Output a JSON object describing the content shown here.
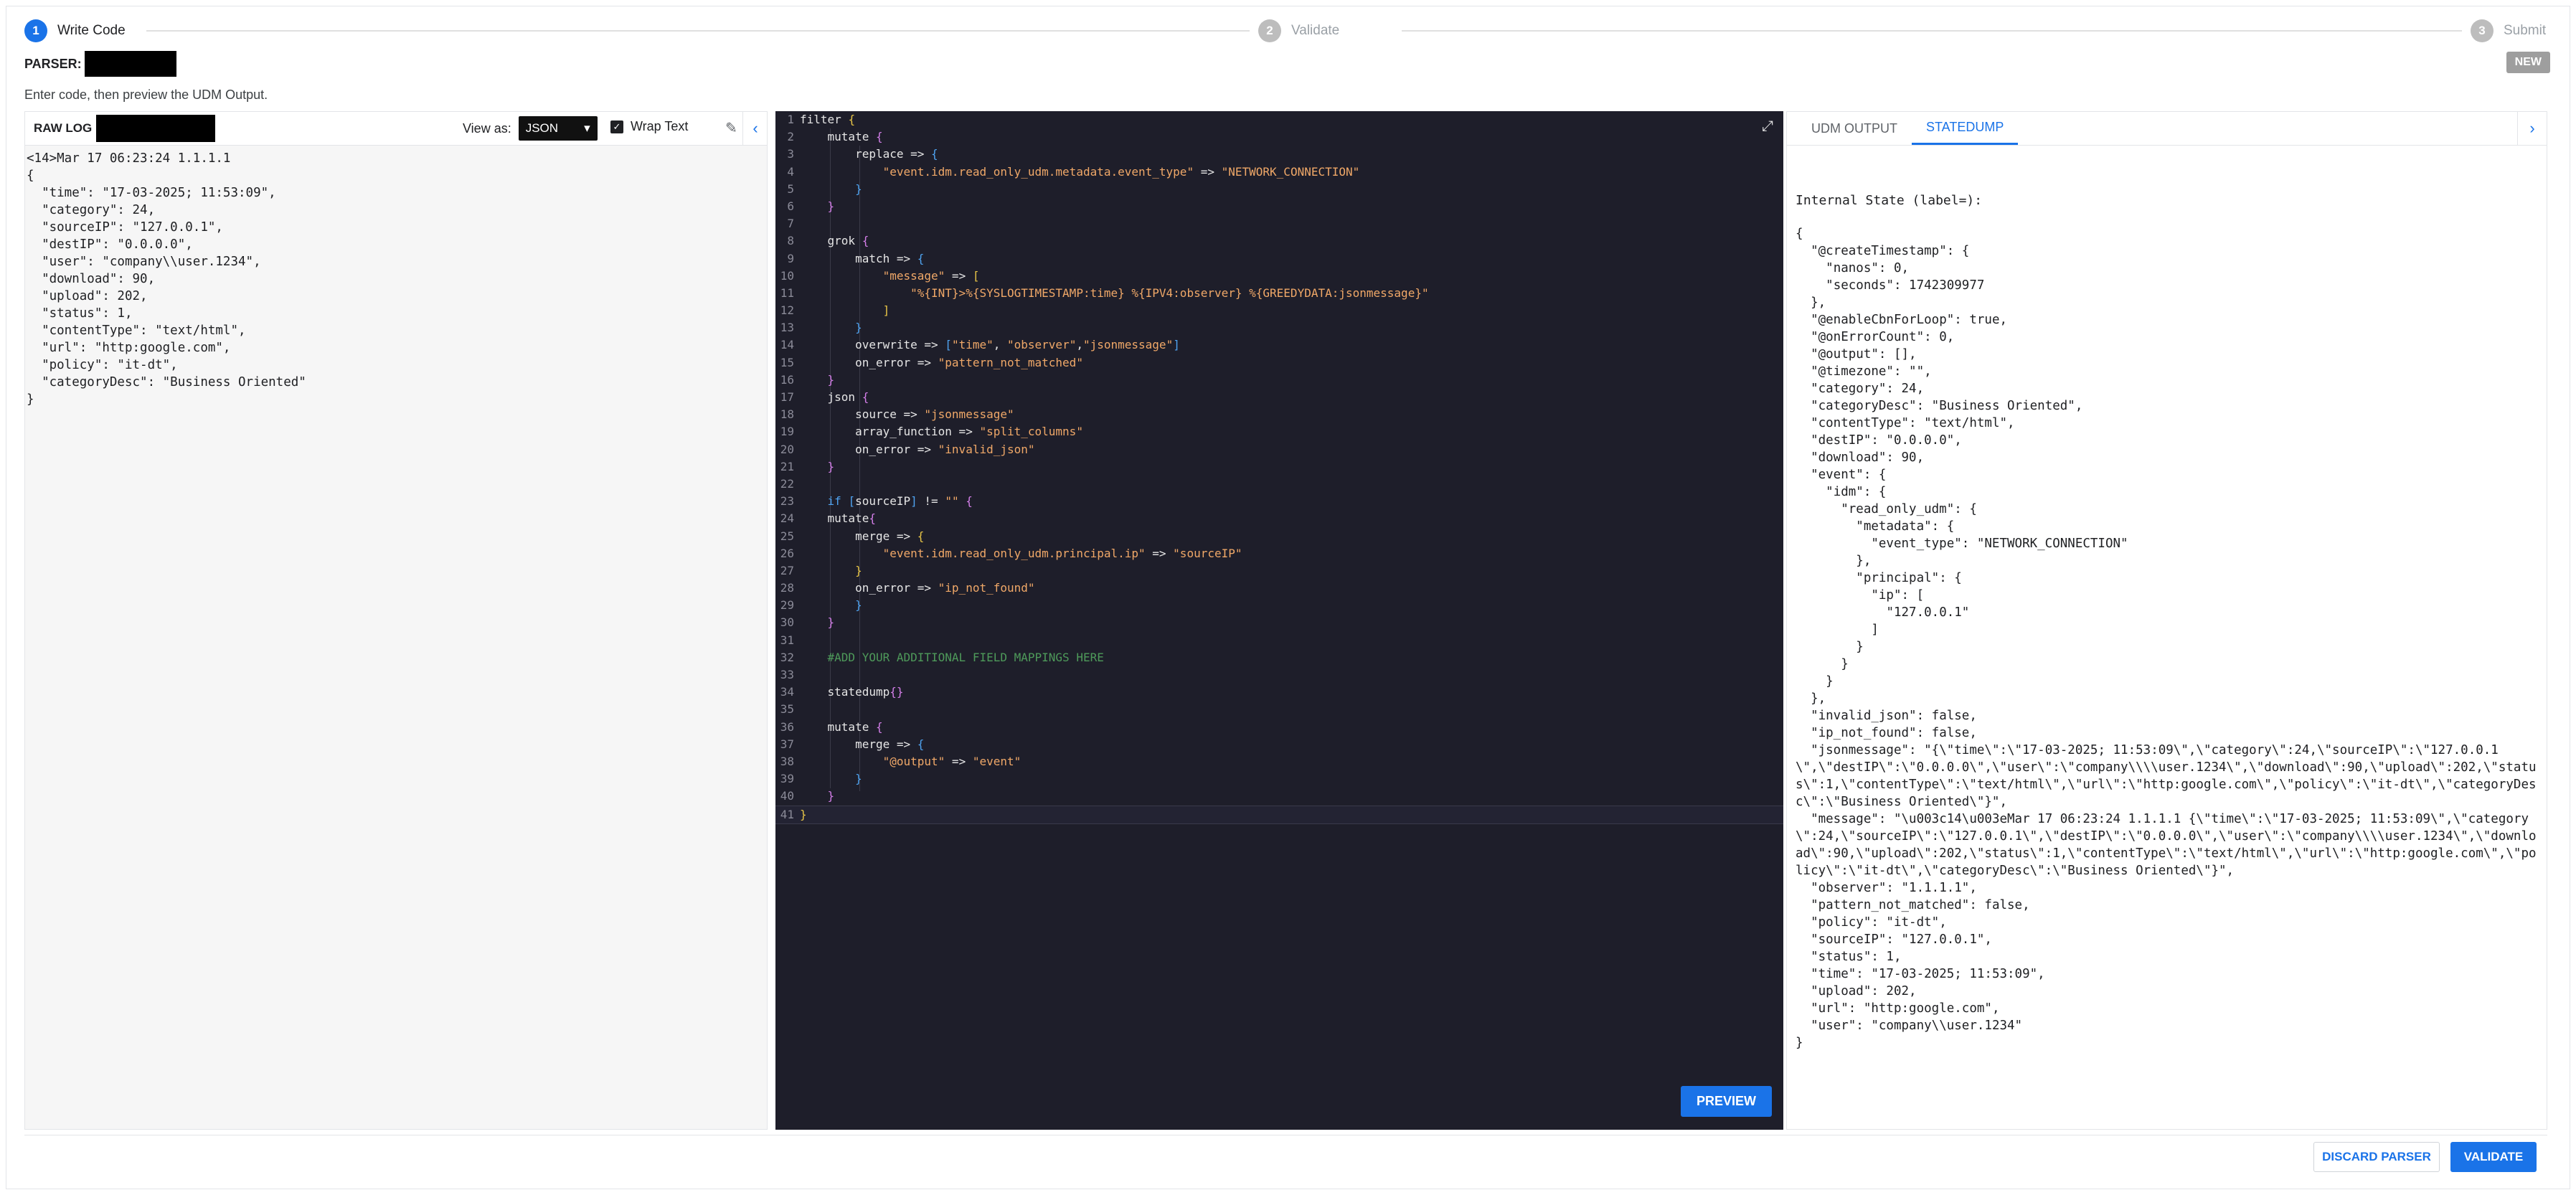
{
  "stepper": {
    "steps": [
      {
        "num": "1",
        "label": "Write Code"
      },
      {
        "num": "2",
        "label": "Validate"
      },
      {
        "num": "3",
        "label": "Submit"
      }
    ]
  },
  "header": {
    "parser_label": "PARSER:",
    "new_badge": "NEW",
    "instructions": "Enter code, then preview the UDM Output."
  },
  "left_panel": {
    "raw_log_label": "RAW LOG",
    "view_as_label": "View as:",
    "view_as_value": "JSON",
    "wrap_text_label": "Wrap Text",
    "raw_log_text": "<14>Mar 17 06:23:24 1.1.1.1\n{\n  \"time\": \"17-03-2025; 11:53:09\",\n  \"category\": 24,\n  \"sourceIP\": \"127.0.0.1\",\n  \"destIP\": \"0.0.0.0\",\n  \"user\": \"company\\\\user.1234\",\n  \"download\": 90,\n  \"upload\": 202,\n  \"status\": 1,\n  \"contentType\": \"text/html\",\n  \"url\": \"http:google.com\",\n  \"policy\": \"it-dt\",\n  \"categoryDesc\": \"Business Oriented\"\n}"
  },
  "editor": {
    "preview_label": "PREVIEW",
    "lines": [
      [
        {
          "t": "filter ",
          "c": "k"
        },
        {
          "t": "{",
          "c": "b1"
        }
      ],
      [
        {
          "t": "    mutate ",
          "c": "k"
        },
        {
          "t": "{",
          "c": "b2"
        }
      ],
      [
        {
          "t": "        replace => ",
          "c": "k"
        },
        {
          "t": "{",
          "c": "b3"
        }
      ],
      [
        {
          "t": "            \"event.idm.read_only_udm.metadata.event_type\"",
          "c": "s"
        },
        {
          "t": " => ",
          "c": "op"
        },
        {
          "t": "\"NETWORK_CONNECTION\"",
          "c": "s"
        }
      ],
      [
        {
          "t": "        ",
          "c": "k"
        },
        {
          "t": "}",
          "c": "b3"
        }
      ],
      [
        {
          "t": "    ",
          "c": "k"
        },
        {
          "t": "}",
          "c": "b2"
        }
      ],
      [],
      [
        {
          "t": "    grok ",
          "c": "k"
        },
        {
          "t": "{",
          "c": "b2"
        }
      ],
      [
        {
          "t": "        match => ",
          "c": "k"
        },
        {
          "t": "{",
          "c": "b3"
        }
      ],
      [
        {
          "t": "            \"message\"",
          "c": "s"
        },
        {
          "t": " => ",
          "c": "op"
        },
        {
          "t": "[",
          "c": "b1"
        }
      ],
      [
        {
          "t": "                \"%{INT}>%{SYSLOGTIMESTAMP:time} %{IPV4:observer} %{GREEDYDATA:jsonmessage}\"",
          "c": "s"
        }
      ],
      [
        {
          "t": "            ",
          "c": "k"
        },
        {
          "t": "]",
          "c": "b1"
        }
      ],
      [
        {
          "t": "        ",
          "c": "k"
        },
        {
          "t": "}",
          "c": "b3"
        }
      ],
      [
        {
          "t": "        overwrite => ",
          "c": "k"
        },
        {
          "t": "[",
          "c": "b3"
        },
        {
          "t": "\"time\"",
          "c": "s"
        },
        {
          "t": ", ",
          "c": "op"
        },
        {
          "t": "\"observer\"",
          "c": "s"
        },
        {
          "t": ",",
          "c": "op"
        },
        {
          "t": "\"jsonmessage\"",
          "c": "s"
        },
        {
          "t": "]",
          "c": "b3"
        }
      ],
      [
        {
          "t": "        on_error => ",
          "c": "k"
        },
        {
          "t": "\"pattern_not_matched\"",
          "c": "s"
        }
      ],
      [
        {
          "t": "    ",
          "c": "k"
        },
        {
          "t": "}",
          "c": "b2"
        }
      ],
      [
        {
          "t": "    json ",
          "c": "k"
        },
        {
          "t": "{",
          "c": "b2"
        }
      ],
      [
        {
          "t": "        source => ",
          "c": "k"
        },
        {
          "t": "\"jsonmessage\"",
          "c": "s"
        }
      ],
      [
        {
          "t": "        array_function => ",
          "c": "k"
        },
        {
          "t": "\"split_columns\"",
          "c": "s"
        }
      ],
      [
        {
          "t": "        on_error => ",
          "c": "k"
        },
        {
          "t": "\"invalid_json\"",
          "c": "s"
        }
      ],
      [
        {
          "t": "    ",
          "c": "k"
        },
        {
          "t": "}",
          "c": "b2"
        }
      ],
      [],
      [
        {
          "t": "    if ",
          "c": "b3"
        },
        {
          "t": "[",
          "c": "b3"
        },
        {
          "t": "sourceIP",
          "c": "k"
        },
        {
          "t": "]",
          "c": "b3"
        },
        {
          "t": " != ",
          "c": "op"
        },
        {
          "t": "\"\"",
          "c": "s"
        },
        {
          "t": " ",
          "c": "op"
        },
        {
          "t": "{",
          "c": "b2"
        }
      ],
      [
        {
          "t": "    mutate",
          "c": "k"
        },
        {
          "t": "{",
          "c": "b2"
        }
      ],
      [
        {
          "t": "        merge => ",
          "c": "k"
        },
        {
          "t": "{",
          "c": "b1"
        }
      ],
      [
        {
          "t": "            \"event.idm.read_only_udm.principal.ip\"",
          "c": "s"
        },
        {
          "t": " => ",
          "c": "op"
        },
        {
          "t": "\"sourceIP\"",
          "c": "s"
        }
      ],
      [
        {
          "t": "        ",
          "c": "k"
        },
        {
          "t": "}",
          "c": "b1"
        }
      ],
      [
        {
          "t": "        on_error => ",
          "c": "k"
        },
        {
          "t": "\"ip_not_found\"",
          "c": "s"
        }
      ],
      [
        {
          "t": "        ",
          "c": "k"
        },
        {
          "t": "}",
          "c": "b3"
        }
      ],
      [
        {
          "t": "    ",
          "c": "k"
        },
        {
          "t": "}",
          "c": "b2"
        }
      ],
      [],
      [
        {
          "t": "    #ADD YOUR ADDITIONAL FIELD MAPPINGS HERE",
          "c": "c"
        }
      ],
      [],
      [
        {
          "t": "    statedump",
          "c": "k"
        },
        {
          "t": "{}",
          "c": "b2"
        }
      ],
      [],
      [
        {
          "t": "    mutate ",
          "c": "k"
        },
        {
          "t": "{",
          "c": "b2"
        }
      ],
      [
        {
          "t": "        merge => ",
          "c": "k"
        },
        {
          "t": "{",
          "c": "b3"
        }
      ],
      [
        {
          "t": "            \"@output\"",
          "c": "s"
        },
        {
          "t": " => ",
          "c": "op"
        },
        {
          "t": "\"event\"",
          "c": "s"
        }
      ],
      [
        {
          "t": "        ",
          "c": "k"
        },
        {
          "t": "}",
          "c": "b3"
        }
      ],
      [
        {
          "t": "    ",
          "c": "k"
        },
        {
          "t": "}",
          "c": "b2"
        }
      ],
      [
        {
          "t": "}",
          "c": "b1"
        }
      ]
    ]
  },
  "right_panel": {
    "tabs": [
      {
        "label": "UDM OUTPUT",
        "active": false
      },
      {
        "label": "STATEDUMP",
        "active": true
      }
    ],
    "state_title": "Internal State (label=):",
    "state_text": "{\n  \"@createTimestamp\": {\n    \"nanos\": 0,\n    \"seconds\": 1742309977\n  },\n  \"@enableCbnForLoop\": true,\n  \"@onErrorCount\": 0,\n  \"@output\": [],\n  \"@timezone\": \"\",\n  \"category\": 24,\n  \"categoryDesc\": \"Business Oriented\",\n  \"contentType\": \"text/html\",\n  \"destIP\": \"0.0.0.0\",\n  \"download\": 90,\n  \"event\": {\n    \"idm\": {\n      \"read_only_udm\": {\n        \"metadata\": {\n          \"event_type\": \"NETWORK_CONNECTION\"\n        },\n        \"principal\": {\n          \"ip\": [\n            \"127.0.0.1\"\n          ]\n        }\n      }\n    }\n  },\n  \"invalid_json\": false,\n  \"ip_not_found\": false,\n  \"jsonmessage\": \"{\\\"time\\\":\\\"17-03-2025; 11:53:09\\\",\\\"category\\\":24,\\\"sourceIP\\\":\\\"127.0.0.1\\\",\\\"destIP\\\":\\\"0.0.0.0\\\",\\\"user\\\":\\\"company\\\\\\\\user.1234\\\",\\\"download\\\":90,\\\"upload\\\":202,\\\"status\\\":1,\\\"contentType\\\":\\\"text/html\\\",\\\"url\\\":\\\"http:google.com\\\",\\\"policy\\\":\\\"it-dt\\\",\\\"categoryDesc\\\":\\\"Business Oriented\\\"}\",\n  \"message\": \"\\u003c14\\u003eMar 17 06:23:24 1.1.1.1 {\\\"time\\\":\\\"17-03-2025; 11:53:09\\\",\\\"category\\\":24,\\\"sourceIP\\\":\\\"127.0.0.1\\\",\\\"destIP\\\":\\\"0.0.0.0\\\",\\\"user\\\":\\\"company\\\\\\\\user.1234\\\",\\\"download\\\":90,\\\"upload\\\":202,\\\"status\\\":1,\\\"contentType\\\":\\\"text/html\\\",\\\"url\\\":\\\"http:google.com\\\",\\\"policy\\\":\\\"it-dt\\\",\\\"categoryDesc\\\":\\\"Business Oriented\\\"}\",\n  \"observer\": \"1.1.1.1\",\n  \"pattern_not_matched\": false,\n  \"policy\": \"it-dt\",\n  \"sourceIP\": \"127.0.0.1\",\n  \"status\": 1,\n  \"time\": \"17-03-2025; 11:53:09\",\n  \"upload\": 202,\n  \"url\": \"http:google.com\",\n  \"user\": \"company\\\\user.1234\"\n}"
  },
  "footer": {
    "discard_label": "DISCARD PARSER",
    "validate_label": "VALIDATE"
  },
  "colors": {
    "accent": "#1a73e8",
    "editor_bg": "#1e1e2a",
    "string": "#f0a868",
    "comment": "#4e9a5a"
  }
}
